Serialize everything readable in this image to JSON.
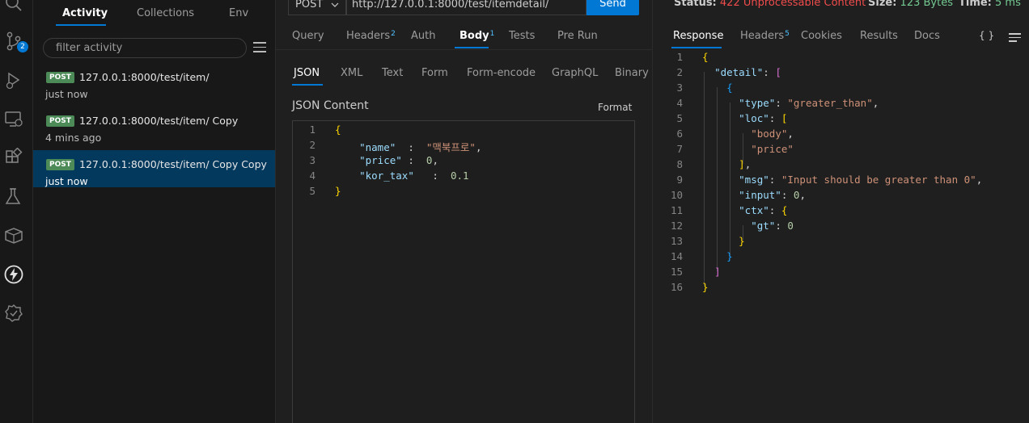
{
  "sidebar": {
    "tabs": [
      "Activity",
      "Collections",
      "Env"
    ],
    "filter_placeholder": "filter activity",
    "badge_count": "2",
    "requests": [
      {
        "method": "POST",
        "url": "127.0.0.1:8000/test/item/",
        "time": "just now",
        "selected": false
      },
      {
        "method": "POST",
        "url": "127.0.0.1:8000/test/item/ Copy",
        "time": "4 mins ago",
        "selected": false
      },
      {
        "method": "POST",
        "url": "127.0.0.1:8000/test/item/ Copy Copy",
        "time": "just now",
        "selected": true
      }
    ]
  },
  "request": {
    "method": "POST",
    "url": "http://127.0.0.1:8000/test/itemdetail/",
    "send_label": "Send",
    "tabs": {
      "query": "Query",
      "headers": "Headers",
      "headers_count": "2",
      "auth": "Auth",
      "body": "Body",
      "body_count": "1",
      "tests": "Tests",
      "prerun": "Pre Run"
    },
    "body_tabs": [
      "JSON",
      "XML",
      "Text",
      "Form",
      "Form-encode",
      "GraphQL",
      "Binary"
    ],
    "content_label": "JSON Content",
    "format_label": "Format",
    "body_lines": [
      "{",
      "    \"name\"  :  \"맥북프로\",",
      "    \"price\" :  0,",
      "    \"kor_tax\"   :  0.1",
      "}"
    ]
  },
  "response": {
    "status_label": "Status:",
    "status_value": "422 Unprocessable Content",
    "size_label": "Size:",
    "size_value": "123 Bytes",
    "time_label": "Time:",
    "time_value": "5 ms",
    "tabs": {
      "response": "Response",
      "headers": "Headers",
      "headers_count": "5",
      "cookies": "Cookies",
      "results": "Results",
      "docs": "Docs"
    },
    "braces_icon_label": "{ }",
    "body_lines": [
      "{",
      "  \"detail\": [",
      "    {",
      "      \"type\": \"greater_than\",",
      "      \"loc\": [",
      "        \"body\",",
      "        \"price\"",
      "      ],",
      "      \"msg\": \"Input should be greater than 0\",",
      "      \"input\": 0,",
      "      \"ctx\": {",
      "        \"gt\": 0",
      "      }",
      "    }",
      "  ]",
      "}"
    ]
  },
  "colors": {
    "accent": "#0078d4",
    "post_badge": "#4c8a57",
    "error": "#f14c4c",
    "ok": "#73c991"
  }
}
